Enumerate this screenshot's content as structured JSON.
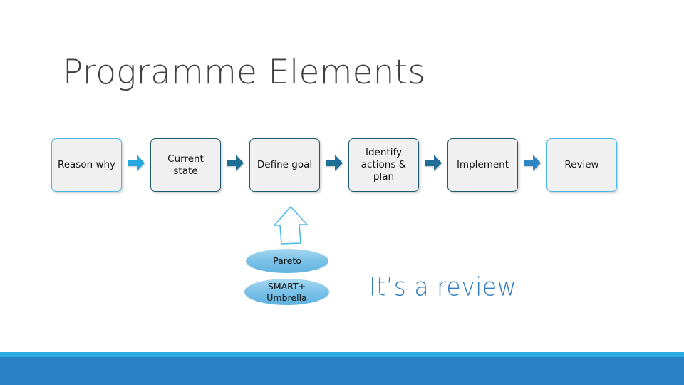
{
  "slide": {
    "title": "Programme Elements",
    "background_color": "#FFFFFF"
  },
  "process": {
    "steps": [
      {
        "label": "Reason why",
        "border_style": "light",
        "border_color": "#4DB4E8"
      },
      {
        "label": "Current\nstate",
        "border_style": "dark",
        "border_color": "#1E5B6E"
      },
      {
        "label": "Define goal",
        "border_style": "dark",
        "border_color": "#1E5B6E"
      },
      {
        "label": "Identify\nactions &\nplan",
        "border_style": "dark",
        "border_color": "#1E5B6E"
      },
      {
        "label": "Implement",
        "border_style": "dark",
        "border_color": "#1E5B6E"
      },
      {
        "label": "Review",
        "border_style": "light",
        "border_color": "#4DB4E8"
      }
    ],
    "arrows": [
      {
        "name": "arrow-1",
        "color": "#29A8DF"
      },
      {
        "name": "arrow-2",
        "color": "#1F6E96"
      },
      {
        "name": "arrow-3",
        "color": "#1F6E96"
      },
      {
        "name": "arrow-4",
        "color": "#1F6E96"
      },
      {
        "name": "arrow-5",
        "color": "#2E85C3"
      }
    ]
  },
  "callout": {
    "up_arrow_color": "#4DB8E8",
    "ellipses": [
      {
        "label": "Pareto"
      },
      {
        "label": "SMART+\nUmbrella"
      }
    ],
    "note": "It’s a review",
    "note_color": "#2E7EBF"
  },
  "footer": {
    "strip_color": "#29ABE2",
    "band_color": "#2A80C4"
  }
}
